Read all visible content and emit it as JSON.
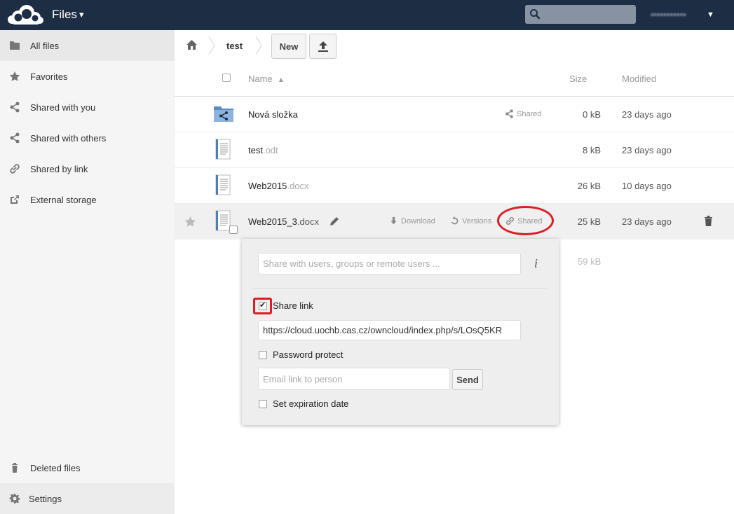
{
  "header": {
    "app_title": "Files",
    "app_caret": "▾",
    "search_placeholder": "",
    "user_name": "▪▪▪▪▪▪▪▪▪▪▪",
    "user_caret": "▼"
  },
  "sidebar": {
    "items": [
      {
        "label": "All files",
        "icon": "folder-icon"
      },
      {
        "label": "Favorites",
        "icon": "star-icon"
      },
      {
        "label": "Shared with you",
        "icon": "share-icon"
      },
      {
        "label": "Shared with others",
        "icon": "share-icon"
      },
      {
        "label": "Shared by link",
        "icon": "link-icon"
      },
      {
        "label": "External storage",
        "icon": "external-icon"
      }
    ],
    "deleted_label": "Deleted files",
    "settings_label": "Settings"
  },
  "breadcrumb": {
    "current": "test"
  },
  "toolbar": {
    "new_label": "New"
  },
  "table": {
    "headers": {
      "name": "Name",
      "sort_indicator": "▲",
      "size": "Size",
      "modified": "Modified"
    },
    "rows": [
      {
        "name": "Nová složka",
        "ext": "",
        "size": "0 kB",
        "modified": "23 days ago",
        "shared_label": "Shared"
      },
      {
        "name": "test",
        "ext": ".odt",
        "size": "8 kB",
        "modified": "23 days ago"
      },
      {
        "name": "Web2015",
        "ext": ".docx",
        "size": "26 kB",
        "modified": "10 days ago"
      },
      {
        "name": "Web2015_3",
        "ext": ".docx",
        "size": "25 kB",
        "modified": "23 days ago",
        "download_label": "Download",
        "versions_label": "Versions",
        "shared_label": "Shared"
      }
    ],
    "faded_size": "59 kB"
  },
  "share_dropdown": {
    "share_placeholder": "Share with users, groups or remote users ...",
    "info_label": "i",
    "share_link_label": "Share link",
    "share_link_checked": true,
    "link_url": "https://cloud.uochb.cas.cz/owncloud/index.php/s/LOsQ5KR",
    "password_label": "Password protect",
    "email_placeholder": "Email link to person",
    "send_label": "Send",
    "expiration_label": "Set expiration date"
  },
  "colors": {
    "header_bg": "#1d2d44",
    "highlight_red": "#e01b24"
  }
}
